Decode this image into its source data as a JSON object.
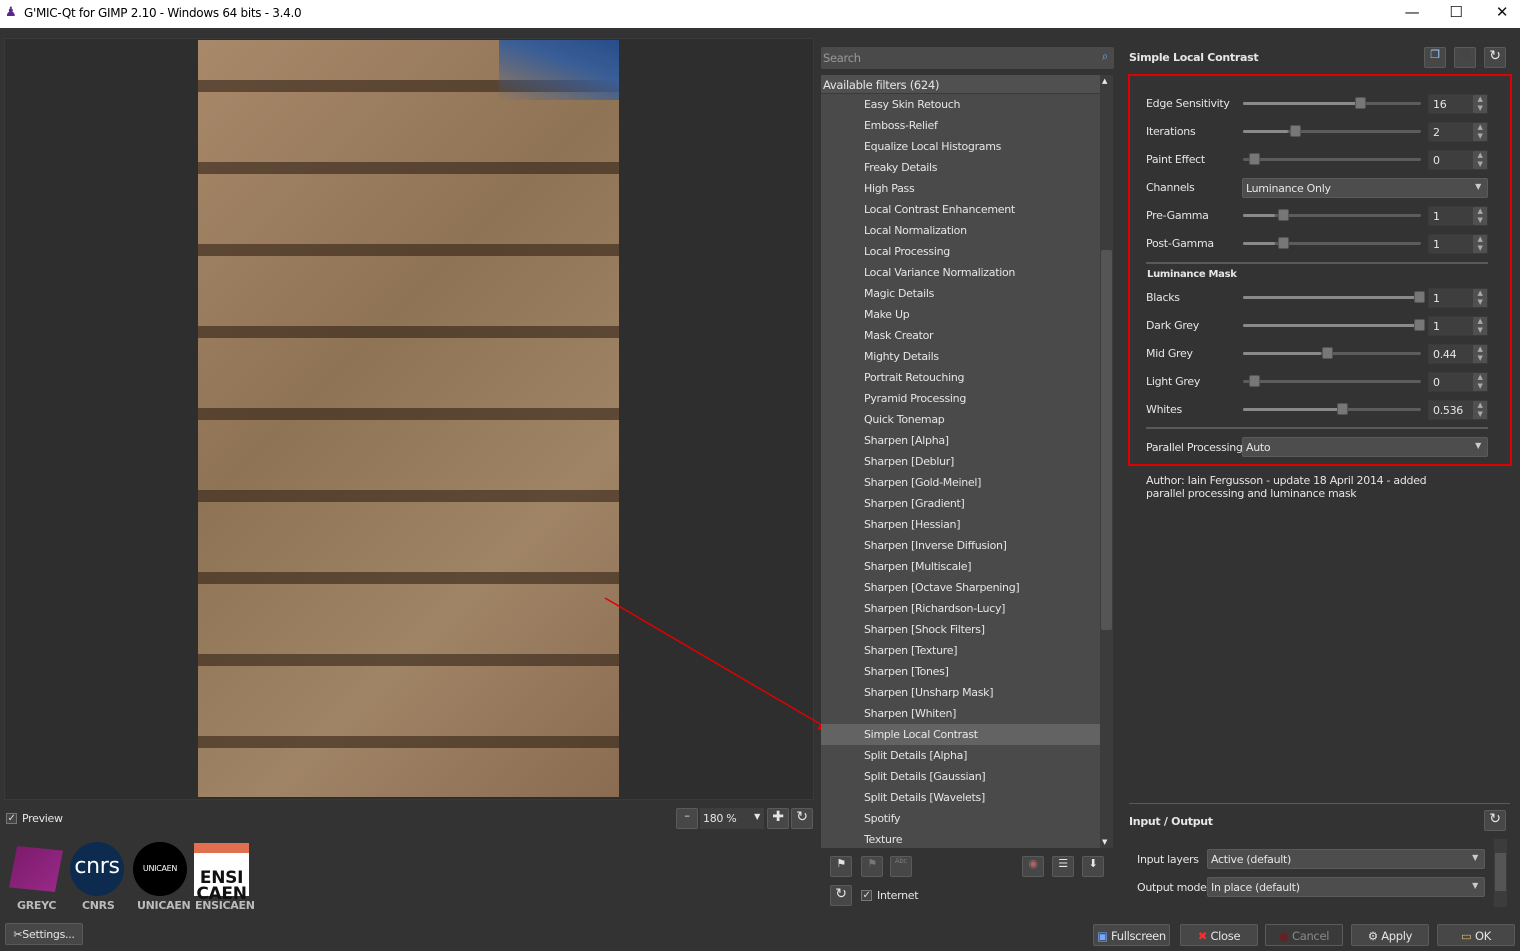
{
  "window": {
    "title": "G'MIC-Qt for GIMP 2.10 - Windows 64 bits - 3.4.0",
    "minimize": "—",
    "maximize": "☐",
    "close": "✕"
  },
  "preview": {
    "checkbox_label": "Preview",
    "checked": true,
    "zoom": "180 %"
  },
  "logos": [
    "GREYC",
    "CNRS",
    "UNICAEN",
    "ENSICAEN"
  ],
  "logo_text": {
    "cnrs": "cnrs",
    "unicaen": "UNICAEN",
    "ensicaen_top": "ENSI",
    "ensicaen_bottom": "CAEN"
  },
  "settings_label": "Settings...",
  "filters": {
    "search_placeholder": "Search",
    "header": "Available filters (624)",
    "items": [
      "Easy Skin Retouch",
      "Emboss-Relief",
      "Equalize Local Histograms",
      "Freaky Details",
      "High Pass",
      "Local Contrast Enhancement",
      "Local Normalization",
      "Local Processing",
      "Local Variance Normalization",
      "Magic Details",
      "Make Up",
      "Mask Creator",
      "Mighty Details",
      "Portrait Retouching",
      "Pyramid Processing",
      "Quick Tonemap",
      "Sharpen [Alpha]",
      "Sharpen [Deblur]",
      "Sharpen [Gold-Meinel]",
      "Sharpen [Gradient]",
      "Sharpen [Hessian]",
      "Sharpen [Inverse Diffusion]",
      "Sharpen [Multiscale]",
      "Sharpen [Octave Sharpening]",
      "Sharpen [Richardson-Lucy]",
      "Sharpen [Shock Filters]",
      "Sharpen [Texture]",
      "Sharpen [Tones]",
      "Sharpen [Unsharp Mask]",
      "Sharpen [Whiten]",
      "Simple Local Contrast",
      "Split Details [Alpha]",
      "Split Details [Gaussian]",
      "Split Details [Wavelets]",
      "Spotify",
      "Texture"
    ],
    "selected": "Simple Local Contrast",
    "internet_label": "Internet",
    "internet_checked": true
  },
  "filter": {
    "title": "Simple Local Contrast",
    "params": [
      {
        "label": "Edge Sensitivity",
        "value": "16",
        "fraction": 0.64
      },
      {
        "label": "Iterations",
        "value": "2",
        "fraction": 0.25
      },
      {
        "label": "Paint Effect",
        "value": "0",
        "fraction": 0
      },
      {
        "label": "Channels",
        "value": "Luminance Only",
        "type": "combo"
      },
      {
        "label": "Pre-Gamma",
        "value": "1",
        "fraction": 0.18
      },
      {
        "label": "Post-Gamma",
        "value": "1",
        "fraction": 0.18
      }
    ],
    "mask_title": "Luminance Mask",
    "mask_params": [
      {
        "label": "Blacks",
        "value": "1",
        "fraction": 1
      },
      {
        "label": "Dark Grey",
        "value": "1",
        "fraction": 1
      },
      {
        "label": "Mid Grey",
        "value": "0.44",
        "fraction": 0.44
      },
      {
        "label": "Light Grey",
        "value": "0",
        "fraction": 0
      },
      {
        "label": "Whites",
        "value": "0.536",
        "fraction": 0.536
      }
    ],
    "parallel": {
      "label": "Parallel Processing",
      "value": "Auto"
    },
    "author": "Author: Iain Fergusson - update 18 April 2014 - added parallel processing and luminance mask"
  },
  "io": {
    "title": "Input / Output",
    "input_label": "Input layers",
    "input_value": "Active (default)",
    "output_label": "Output mode",
    "output_value": "In place (default)"
  },
  "buttons": {
    "fullscreen": "Fullscreen",
    "close": "Close",
    "cancel": "Cancel",
    "apply": "Apply",
    "ok": "OK"
  },
  "colors": {
    "highlight": "#e00000",
    "bg": "#333333",
    "list": "#4a4a4a"
  }
}
